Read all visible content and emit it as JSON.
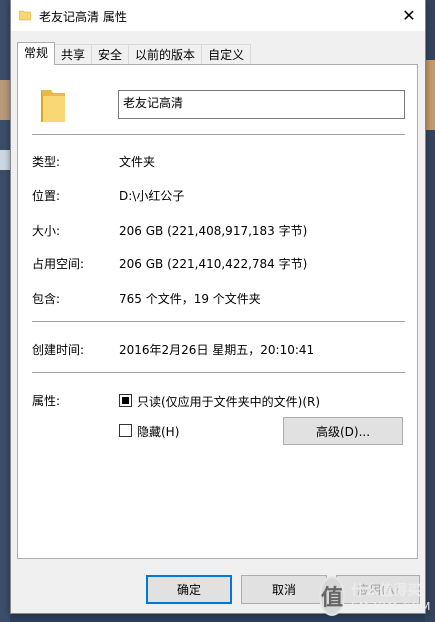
{
  "window": {
    "title": "老友记高清 属性",
    "close_glyph": "✕"
  },
  "tabs": [
    {
      "label": "常规",
      "active": true
    },
    {
      "label": "共享",
      "active": false
    },
    {
      "label": "安全",
      "active": false
    },
    {
      "label": "以前的版本",
      "active": false
    },
    {
      "label": "自定义",
      "active": false
    }
  ],
  "general": {
    "folder_name": "老友记高清",
    "rows": {
      "type": {
        "label": "类型:",
        "value": "文件夹"
      },
      "location": {
        "label": "位置:",
        "value": "D:\\小红公子"
      },
      "size": {
        "label": "大小:",
        "value": "206 GB (221,408,917,183 字节)"
      },
      "size_on_disk": {
        "label": "占用空间:",
        "value": "206 GB (221,410,422,784 字节)"
      },
      "contains": {
        "label": "包含:",
        "value": "765 个文件，19 个文件夹"
      },
      "created": {
        "label": "创建时间:",
        "value": "2016年2月26日 星期五，20:10:41"
      }
    },
    "attributes": {
      "label": "属性:",
      "readonly": {
        "label": "只读(仅应用于文件夹中的文件)(R)",
        "state": "indeterminate"
      },
      "hidden": {
        "label": "隐藏(H)",
        "state": "unchecked"
      },
      "advanced_button": "高级(D)..."
    }
  },
  "footer": {
    "ok": "确定",
    "cancel": "取消",
    "apply": "应用(A)"
  },
  "watermark": {
    "icon_glyph": "值",
    "text_cn": "什么值得买",
    "text_en": "SMZDM.COM"
  },
  "colors": {
    "folder": "#f8d775",
    "default_button_border": "#0078d7"
  }
}
